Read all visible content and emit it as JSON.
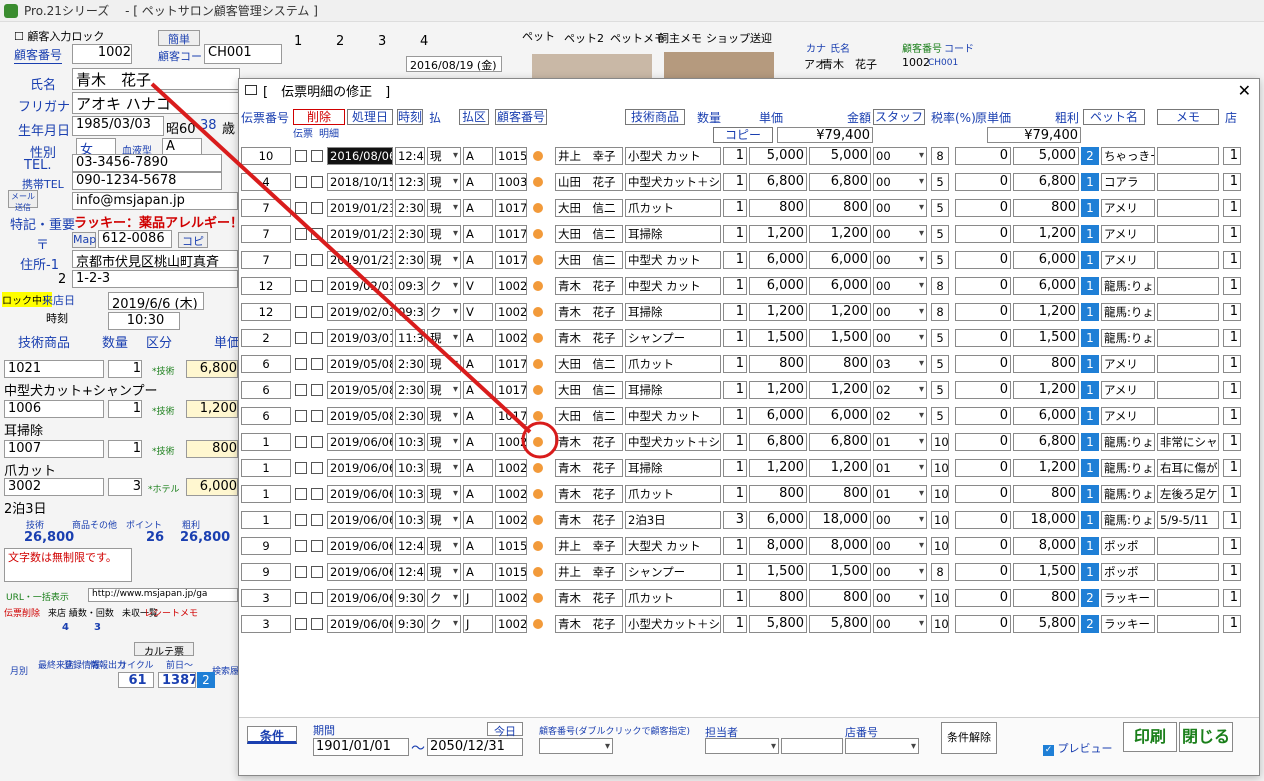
{
  "window": {
    "title": "Pro.21シリーズ　 - [ ペットサロン顧客管理システム ]"
  },
  "background": {
    "lock_label": "顧客入力ロック",
    "customer_no_label": "顧客番号",
    "customer_no": "1002",
    "customer_code_label": "顧客コード",
    "customer_code": "CH001",
    "simple_btn": "簡単",
    "name_label": "氏名",
    "name": "青木　花子",
    "kana_label": "フリガナ",
    "kana": "アオキ ハナコ",
    "birth_label": "生年月日",
    "birth": "1985/03/03",
    "era": "昭60",
    "age": "38",
    "age_unit": "歳",
    "gender_label": "性別",
    "gender": "女",
    "blood_label": "血液型",
    "blood": "A",
    "tel_label": "TEL.",
    "tel": "03-3456-7890",
    "mobile_label": "携帯TEL",
    "mobile": "090-1234-5678",
    "mail_label": "メール送信",
    "mail": "info@msjapan.jp",
    "note_label": "特記・重要",
    "note": "ラッキー：薬品アレルギー！",
    "zip_label": "〒",
    "map_btn": "Map",
    "zip": "612-0086",
    "copy_btn": "コピー",
    "addr1_label": "住所-1",
    "addr1": "京都市伏見区桃山町真斉",
    "addr2_label": "2",
    "addr2": "1-2-3",
    "lock_on": "ロック中！",
    "visit_label": "来店日",
    "visit_date": "2019/6/6 (木)",
    "visit_time": "10:30",
    "time_label": "時刻",
    "grid_header": [
      "技術商品",
      "数量",
      "区分",
      "単価"
    ],
    "items": [
      {
        "code": "1021",
        "qty": "1",
        "kind": "*技術",
        "price": "6,800",
        "name": "中型犬カット+シャンプー"
      },
      {
        "code": "1006",
        "qty": "1",
        "kind": "*技術",
        "price": "1,200",
        "name": "耳掃除"
      },
      {
        "code": "1007",
        "qty": "1",
        "kind": "*技術",
        "price": "800",
        "name": "爪カット"
      },
      {
        "code": "3002",
        "qty": "3",
        "kind": "*ホテル",
        "price": "6,000",
        "name": "2泊3日"
      }
    ],
    "summary_labels": [
      "技術",
      "商品その他",
      "ポイント",
      "粗利"
    ],
    "summary_values": [
      "26,800",
      "26",
      "26,800"
    ],
    "memo_text": "文字数は無制限です。",
    "url_label": "URL・一括表示",
    "url": "http://www.msjapan.jp/ga",
    "tabs": [
      "ペット",
      "ペット2",
      "ペットメモ",
      "飼主メモ",
      "ショップ",
      "送迎"
    ],
    "top_tabs": [
      "1",
      "2",
      "3",
      "4"
    ],
    "top_date": "2016/08/19 (金)",
    "list_header": [
      "カナ",
      "氏名",
      "顧客番号",
      "コード"
    ],
    "list_rows": [
      {
        "kana": "アオ",
        "name": "青木　花子",
        "no": "1002",
        "code": "CH001"
      }
    ],
    "karte_btn": "カルテ票",
    "count_values": [
      "61",
      "1387",
      "2"
    ],
    "slip_btns": [
      "伝票削除",
      "来店 績数・回数",
      "未収一覧",
      "レシートメモ"
    ],
    "slip_vals": [
      "4",
      "3"
    ],
    "small_btns": [
      "月別",
      "最終来店",
      "登録情報",
      "情報出力",
      "サイクル",
      "前日～",
      "検索履歴"
    ]
  },
  "dialog": {
    "title": "[　伝票明細の修正　]",
    "headers": {
      "slip_no": "伝票番号",
      "delete": "削除",
      "slip": "伝票",
      "detail": "明細",
      "process_date": "処理日",
      "time": "時刻",
      "pay": "払",
      "pay_kind": "払区",
      "customer_no": "顧客番号",
      "tech_product": "技術商品",
      "qty": "数量",
      "unit_price": "単価",
      "amount": "金額",
      "staff": "スタッフ",
      "tax": "税率(%)",
      "cost": "原単価",
      "profit": "粗利",
      "pet_name": "ペット名",
      "memo": "メモ",
      "store": "店"
    },
    "copy_btn": "コピー",
    "total_amount": "¥79,400",
    "total_profit": "¥79,400",
    "rows": [
      {
        "slip": "10",
        "date": "2016/08/06",
        "time": "12:45",
        "pay": "現",
        "kind": "A",
        "cust": "1015",
        "name": "井上　幸子",
        "item": "小型犬 カット",
        "qty": "1",
        "price": "5,000",
        "amount": "5,000",
        "staff": "00",
        "tax": "8",
        "cost": "0",
        "profit": "5,000",
        "badge": "2",
        "pet": "ちゃっきー",
        "memo": "",
        "store": "1",
        "dark": true
      },
      {
        "slip": "4",
        "date": "2018/10/15",
        "time": "12:30",
        "pay": "現",
        "kind": "A",
        "cust": "1003",
        "name": "山田　花子",
        "item": "中型犬カット＋シャン",
        "qty": "1",
        "price": "6,800",
        "amount": "6,800",
        "staff": "00",
        "tax": "5",
        "cost": "0",
        "profit": "6,800",
        "badge": "1",
        "pet": "コアラ",
        "memo": "",
        "store": "1"
      },
      {
        "slip": "7",
        "date": "2019/01/23",
        "time": "2:30",
        "pay": "現",
        "kind": "A",
        "cust": "1017",
        "name": "大田　信二",
        "item": "爪カット",
        "qty": "1",
        "price": "800",
        "amount": "800",
        "staff": "00",
        "tax": "5",
        "cost": "0",
        "profit": "800",
        "badge": "1",
        "pet": "アメリ",
        "memo": "",
        "store": "1"
      },
      {
        "slip": "7",
        "date": "2019/01/23",
        "time": "2:30",
        "pay": "現",
        "kind": "A",
        "cust": "1017",
        "name": "大田　信二",
        "item": "耳掃除",
        "qty": "1",
        "price": "1,200",
        "amount": "1,200",
        "staff": "00",
        "tax": "5",
        "cost": "0",
        "profit": "1,200",
        "badge": "1",
        "pet": "アメリ",
        "memo": "",
        "store": "1"
      },
      {
        "slip": "7",
        "date": "2019/01/23",
        "time": "2:30",
        "pay": "現",
        "kind": "A",
        "cust": "1017",
        "name": "大田　信二",
        "item": "中型犬 カット",
        "qty": "1",
        "price": "6,000",
        "amount": "6,000",
        "staff": "00",
        "tax": "5",
        "cost": "0",
        "profit": "6,000",
        "badge": "1",
        "pet": "アメリ",
        "memo": "",
        "store": "1"
      },
      {
        "slip": "12",
        "date": "2019/02/03",
        "time": "09:30",
        "pay": "ク",
        "kind": "V",
        "cust": "1002",
        "name": "青木　花子",
        "item": "中型犬 カット",
        "qty": "1",
        "price": "6,000",
        "amount": "6,000",
        "staff": "00",
        "tax": "8",
        "cost": "0",
        "profit": "6,000",
        "badge": "1",
        "pet": "龍馬:りょ",
        "memo": "",
        "store": "1"
      },
      {
        "slip": "12",
        "date": "2019/02/03",
        "time": "09:30",
        "pay": "ク",
        "kind": "V",
        "cust": "1002",
        "name": "青木　花子",
        "item": "耳掃除",
        "qty": "1",
        "price": "1,200",
        "amount": "1,200",
        "staff": "00",
        "tax": "8",
        "cost": "0",
        "profit": "1,200",
        "badge": "1",
        "pet": "龍馬:りょ",
        "memo": "",
        "store": "1"
      },
      {
        "slip": "2",
        "date": "2019/03/01",
        "time": "11:30",
        "pay": "現",
        "kind": "A",
        "cust": "1002",
        "name": "青木　花子",
        "item": "シャンプー",
        "qty": "1",
        "price": "1,500",
        "amount": "1,500",
        "staff": "00",
        "tax": "5",
        "cost": "0",
        "profit": "1,500",
        "badge": "1",
        "pet": "龍馬:りょ",
        "memo": "",
        "store": "1"
      },
      {
        "slip": "6",
        "date": "2019/05/08",
        "time": "2:30",
        "pay": "現",
        "kind": "A",
        "cust": "1017",
        "name": "大田　信二",
        "item": "爪カット",
        "qty": "1",
        "price": "800",
        "amount": "800",
        "staff": "03",
        "tax": "5",
        "cost": "0",
        "profit": "800",
        "badge": "1",
        "pet": "アメリ",
        "memo": "",
        "store": "1"
      },
      {
        "slip": "6",
        "date": "2019/05/08",
        "time": "2:30",
        "pay": "現",
        "kind": "A",
        "cust": "1017",
        "name": "大田　信二",
        "item": "耳掃除",
        "qty": "1",
        "price": "1,200",
        "amount": "1,200",
        "staff": "02",
        "tax": "5",
        "cost": "0",
        "profit": "1,200",
        "badge": "1",
        "pet": "アメリ",
        "memo": "",
        "store": "1"
      },
      {
        "slip": "6",
        "date": "2019/05/08",
        "time": "2:30",
        "pay": "現",
        "kind": "A",
        "cust": "1017",
        "name": "大田　信二",
        "item": "中型犬 カット",
        "qty": "1",
        "price": "6,000",
        "amount": "6,000",
        "staff": "02",
        "tax": "5",
        "cost": "0",
        "profit": "6,000",
        "badge": "1",
        "pet": "アメリ",
        "memo": "",
        "store": "1"
      },
      {
        "slip": "1",
        "date": "2019/06/06",
        "time": "10:30",
        "pay": "現",
        "kind": "A",
        "cust": "1002",
        "name": "青木　花子",
        "item": "中型犬カット＋シャン",
        "qty": "1",
        "price": "6,800",
        "amount": "6,800",
        "staff": "01",
        "tax": "10",
        "cost": "0",
        "profit": "6,800",
        "badge": "1",
        "pet": "龍馬:りょ",
        "memo": "非常にシャン",
        "store": "1"
      },
      {
        "slip": "1",
        "date": "2019/06/06",
        "time": "10:30",
        "pay": "現",
        "kind": "A",
        "cust": "1002",
        "name": "青木　花子",
        "item": "耳掃除",
        "qty": "1",
        "price": "1,200",
        "amount": "1,200",
        "staff": "01",
        "tax": "10",
        "cost": "0",
        "profit": "1,200",
        "badge": "1",
        "pet": "龍馬:りょ",
        "memo": "右耳に傷があ",
        "store": "1"
      },
      {
        "slip": "1",
        "date": "2019/06/06",
        "time": "10:30",
        "pay": "現",
        "kind": "A",
        "cust": "1002",
        "name": "青木　花子",
        "item": "爪カット",
        "qty": "1",
        "price": "800",
        "amount": "800",
        "staff": "01",
        "tax": "10",
        "cost": "0",
        "profit": "800",
        "badge": "1",
        "pet": "龍馬:りょ",
        "memo": "左後ろ足ケガ",
        "store": "1"
      },
      {
        "slip": "1",
        "date": "2019/06/06",
        "time": "10:30",
        "pay": "現",
        "kind": "A",
        "cust": "1002",
        "name": "青木　花子",
        "item": "2泊3日",
        "qty": "3",
        "price": "6,000",
        "amount": "18,000",
        "staff": "00",
        "tax": "10",
        "cost": "0",
        "profit": "18,000",
        "badge": "1",
        "pet": "龍馬:りょ",
        "memo": "5/9-5/11",
        "store": "1"
      },
      {
        "slip": "9",
        "date": "2019/06/06",
        "time": "12:45",
        "pay": "現",
        "kind": "A",
        "cust": "1015",
        "name": "井上　幸子",
        "item": "大型犬 カット",
        "qty": "1",
        "price": "8,000",
        "amount": "8,000",
        "staff": "00",
        "tax": "10",
        "cost": "0",
        "profit": "8,000",
        "badge": "1",
        "pet": "ポッポ",
        "memo": "",
        "store": "1"
      },
      {
        "slip": "9",
        "date": "2019/06/06",
        "time": "12:45",
        "pay": "現",
        "kind": "A",
        "cust": "1015",
        "name": "井上　幸子",
        "item": "シャンプー",
        "qty": "1",
        "price": "1,500",
        "amount": "1,500",
        "staff": "00",
        "tax": "8",
        "cost": "0",
        "profit": "1,500",
        "badge": "1",
        "pet": "ポッポ",
        "memo": "",
        "store": "1"
      },
      {
        "slip": "3",
        "date": "2019/06/06",
        "time": "9:30",
        "pay": "ク",
        "kind": "J",
        "cust": "1002",
        "name": "青木　花子",
        "item": "爪カット",
        "qty": "1",
        "price": "800",
        "amount": "800",
        "staff": "00",
        "tax": "10",
        "cost": "0",
        "profit": "800",
        "badge": "2",
        "pet": "ラッキー",
        "memo": "",
        "store": "1"
      },
      {
        "slip": "3",
        "date": "2019/06/06",
        "time": "9:30",
        "pay": "ク",
        "kind": "J",
        "cust": "1002",
        "name": "青木　花子",
        "item": "小型犬カット＋シャン",
        "qty": "1",
        "price": "5,800",
        "amount": "5,800",
        "staff": "00",
        "tax": "10",
        "cost": "0",
        "profit": "5,800",
        "badge": "2",
        "pet": "ラッキー",
        "memo": "",
        "store": "1"
      }
    ],
    "footer": {
      "condition_btn": "条件",
      "period_label": "期間",
      "date_from": "1901/01/01",
      "tilde": "～",
      "date_to": "2050/12/31",
      "today_btn": "今日",
      "customer_no_label": "顧客番号(ダブルクリックで顧客指定)",
      "staff_label": "担当者",
      "store_label": "店番号",
      "clear_btn": "条件解除",
      "preview_label": "プレビュー",
      "print_btn": "印刷",
      "close_btn": "閉じる"
    }
  },
  "colors": {
    "accent_blue": "#1f7fd6",
    "dot_orange": "#f29a3a",
    "annotation_red": "#d91c1c"
  }
}
